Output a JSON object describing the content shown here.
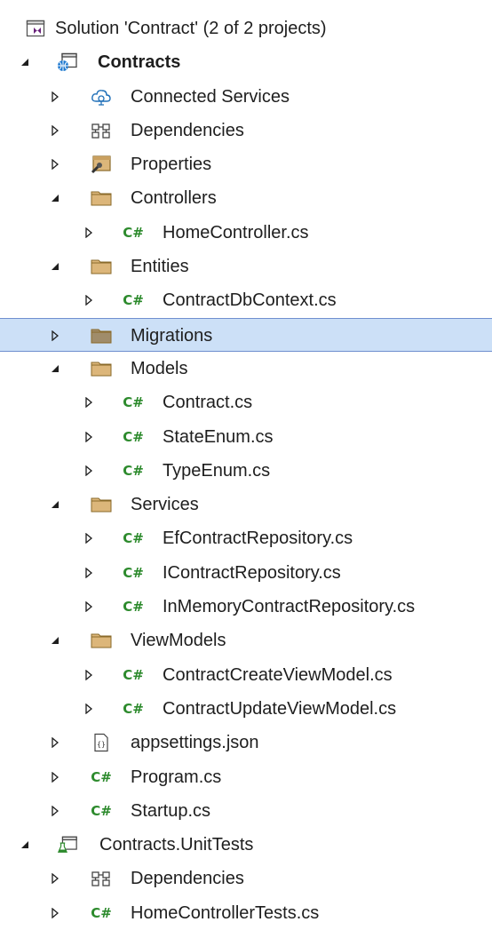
{
  "solution_explorer": {
    "rows": [
      {
        "label": "Solution 'Contract' (2 of 2 projects)",
        "icon": "solution-icon",
        "expander": "none",
        "level": 0
      },
      {
        "label": "Contracts",
        "icon": "web-project-icon",
        "expander": "expanded",
        "level": 0,
        "bold": true
      },
      {
        "label": "Connected Services",
        "icon": "connected-services-icon",
        "expander": "collapsed",
        "level": 1
      },
      {
        "label": "Dependencies",
        "icon": "dependencies-icon",
        "expander": "collapsed",
        "level": 1
      },
      {
        "label": "Properties",
        "icon": "properties-icon",
        "expander": "collapsed",
        "level": 1
      },
      {
        "label": "Controllers",
        "icon": "folder-icon",
        "expander": "expanded",
        "level": 1
      },
      {
        "label": "HomeController.cs",
        "icon": "csharp-file-icon",
        "expander": "collapsed",
        "level": 2
      },
      {
        "label": "Entities",
        "icon": "folder-icon",
        "expander": "expanded",
        "level": 1
      },
      {
        "label": "ContractDbContext.cs",
        "icon": "csharp-file-icon",
        "expander": "collapsed",
        "level": 2
      },
      {
        "label": "Migrations",
        "icon": "folder-icon",
        "expander": "collapsed",
        "level": 1,
        "selected": true
      },
      {
        "label": "Models",
        "icon": "folder-icon",
        "expander": "expanded",
        "level": 1
      },
      {
        "label": "Contract.cs",
        "icon": "csharp-file-icon",
        "expander": "collapsed",
        "level": 2
      },
      {
        "label": "StateEnum.cs",
        "icon": "csharp-file-icon",
        "expander": "collapsed",
        "level": 2
      },
      {
        "label": "TypeEnum.cs",
        "icon": "csharp-file-icon",
        "expander": "collapsed",
        "level": 2
      },
      {
        "label": "Services",
        "icon": "folder-icon",
        "expander": "expanded",
        "level": 1
      },
      {
        "label": "EfContractRepository.cs",
        "icon": "csharp-file-icon",
        "expander": "collapsed",
        "level": 2
      },
      {
        "label": "IContractRepository.cs",
        "icon": "csharp-file-icon",
        "expander": "collapsed",
        "level": 2
      },
      {
        "label": "InMemoryContractRepository.cs",
        "icon": "csharp-file-icon",
        "expander": "collapsed",
        "level": 2
      },
      {
        "label": "ViewModels",
        "icon": "folder-icon",
        "expander": "expanded",
        "level": 1
      },
      {
        "label": "ContractCreateViewModel.cs",
        "icon": "csharp-file-icon",
        "expander": "collapsed",
        "level": 2
      },
      {
        "label": "ContractUpdateViewModel.cs",
        "icon": "csharp-file-icon",
        "expander": "collapsed",
        "level": 2
      },
      {
        "label": "appsettings.json",
        "icon": "json-file-icon",
        "expander": "collapsed",
        "level": 1
      },
      {
        "label": "Program.cs",
        "icon": "csharp-file-icon",
        "expander": "collapsed",
        "level": 1
      },
      {
        "label": "Startup.cs",
        "icon": "csharp-file-icon",
        "expander": "collapsed",
        "level": 1
      },
      {
        "label": "Contracts.UnitTests",
        "icon": "test-project-icon",
        "expander": "expanded",
        "level": 0
      },
      {
        "label": "Dependencies",
        "icon": "dependencies-icon",
        "expander": "collapsed",
        "level": 1
      },
      {
        "label": "HomeControllerTests.cs",
        "icon": "csharp-file-icon",
        "expander": "collapsed",
        "level": 1
      }
    ]
  },
  "colors": {
    "selection_background": "#cce0f7",
    "selection_border": "#6f8fcf",
    "folder_fill": "#dcb67a",
    "folder_selected_fill": "#a08c6a",
    "csharp_green": "#2c8a2c",
    "solution_purple": "#68217a"
  }
}
